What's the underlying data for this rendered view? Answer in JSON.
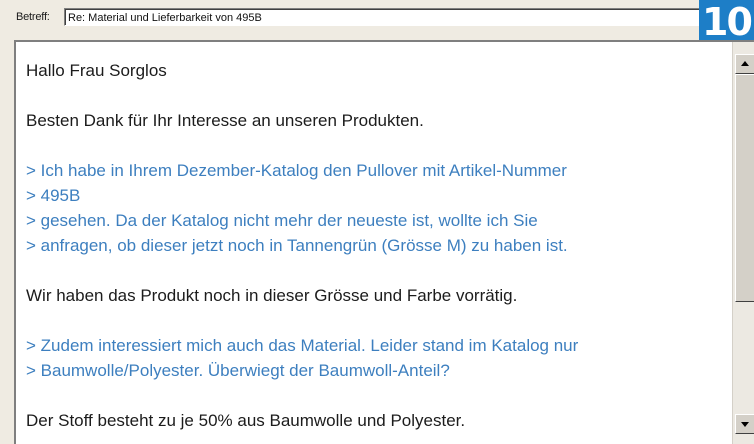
{
  "subject": {
    "label": "Betreff:",
    "value": "Re: Material und Lieferbarkeit von 495B"
  },
  "badge": {
    "number": "10",
    "color": "#1d7ec7"
  },
  "mail": {
    "greeting": "Hallo Frau Sorglos",
    "thanks": "Besten Dank für Ihr Interesse an unseren Produkten.",
    "quote1": [
      "> Ich habe in Ihrem Dezember-Katalog den Pullover mit Artikel-Nummer",
      "> 495B",
      "> gesehen. Da der Katalog nicht mehr der neueste ist, wollte ich Sie",
      "> anfragen, ob dieser jetzt noch in Tannengrün (Grösse M) zu haben ist."
    ],
    "reply1": "Wir haben das Produkt noch in dieser Grösse und Farbe vorrätig.",
    "quote2": [
      "> Zudem interessiert mich auch das Material. Leider stand im Katalog nur",
      "> Baumwolle/Polyester. Überwiegt der Baumwoll-Anteil?"
    ],
    "reply2": "Der Stoff besteht zu je 50% aus Baumwolle und Polyester.",
    "quote_color": "#3d7fbf"
  },
  "scrollbar": {
    "up_icon": "arrow-up-icon",
    "down_icon": "arrow-down-icon"
  }
}
